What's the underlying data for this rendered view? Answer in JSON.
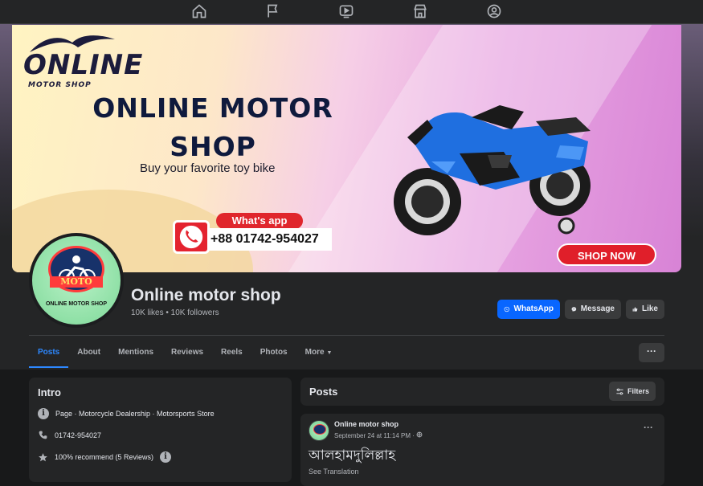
{
  "nav": {
    "icons": [
      "home-icon",
      "flag-icon",
      "video-icon",
      "marketplace-icon",
      "groups-icon"
    ]
  },
  "cover": {
    "logo_text": "ONLINE",
    "logo_sub": "MOTOR SHOP",
    "headline": "ONLINE MOTOR SHOP",
    "tagline": "Buy your favorite toy bike",
    "whatsapp_pill": "What's app",
    "phone": "+88 01742-954027",
    "cta": "SHOP NOW",
    "bike_color": "#1f6fe0"
  },
  "profile": {
    "badge_text": "MOTO",
    "caption": "ONLINE MOTOR SHOP"
  },
  "page": {
    "name": "Online motor shop",
    "stats": "10K likes • 10K followers"
  },
  "actions": {
    "whatsapp": "WhatsApp",
    "message": "Message",
    "like": "Like"
  },
  "tabs": [
    {
      "label": "Posts",
      "active": true
    },
    {
      "label": "About"
    },
    {
      "label": "Mentions"
    },
    {
      "label": "Reviews"
    },
    {
      "label": "Reels"
    },
    {
      "label": "Photos"
    },
    {
      "label": "More"
    }
  ],
  "more_button": "···",
  "intro": {
    "title": "Intro",
    "category": "Page · Motorcycle Dealership · Motorsports Store",
    "phone": "01742-954027",
    "recommend": "100% recommend (5 Reviews)"
  },
  "posts_section": {
    "title": "Posts",
    "filters": "Filters"
  },
  "post": {
    "author": "Online motor shop",
    "time": "September 24 at 11:14 PM · ",
    "body": "আলহামদুলিল্লাহ",
    "see_translation": "See Translation"
  },
  "colors": {
    "accent": "#2d88ff",
    "whatsapp_button": "#0866ff",
    "background": "#18191a",
    "card": "#242526"
  }
}
